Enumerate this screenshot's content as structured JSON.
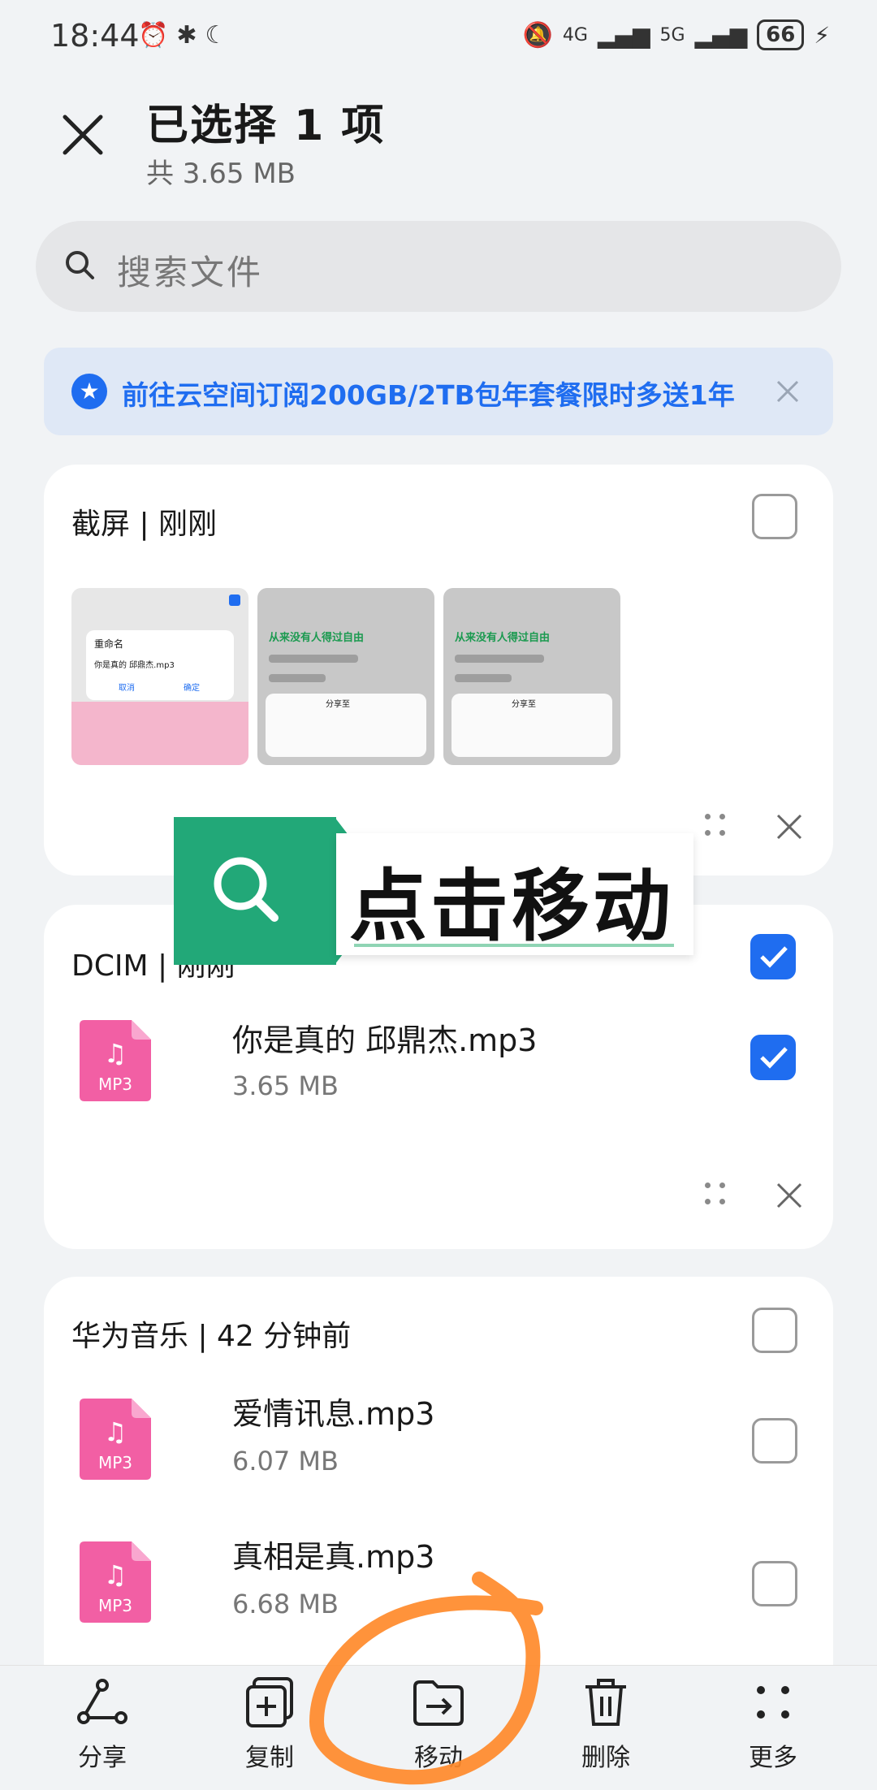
{
  "status_bar": {
    "time": "18:44",
    "network_1": "4G",
    "network_2": "5G",
    "battery": "66"
  },
  "header": {
    "title": "已选择 1 项",
    "subtitle": "共 3.65 MB"
  },
  "search": {
    "placeholder": "搜索文件"
  },
  "promo": {
    "text": "前往云空间订阅200GB/2TB包年套餐限时多送1年",
    "accent_color": "#1f6df0"
  },
  "groups": [
    {
      "title": "截屏 | 刚刚",
      "checked": false,
      "thumbnails": [
        {
          "heading": "重命名",
          "line": "你是真的 邱鼎杰.mp3",
          "cancel": "取消",
          "ok": "确定"
        },
        {
          "heading": "从来没有人得过自由",
          "share": "分享至"
        },
        {
          "heading": "从来没有人得过自由",
          "share": "分享至"
        }
      ]
    },
    {
      "title": "DCIM | 刚刚",
      "checked": true,
      "files": [
        {
          "name": "你是真的 邱鼎杰.mp3",
          "size": "3.65 MB",
          "checked": true
        }
      ]
    },
    {
      "title": "华为音乐 | 42 分钟前",
      "checked": false,
      "files": [
        {
          "name": "爱情讯息.mp3",
          "size": "6.07 MB",
          "checked": false
        },
        {
          "name": "真相是真.mp3",
          "size": "6.68 MB",
          "checked": false
        }
      ]
    }
  ],
  "file_icon_label": "MP3",
  "overlay": {
    "text": "点击移动"
  },
  "toolbar": {
    "share": "分享",
    "copy": "复制",
    "move": "移动",
    "delete": "删除",
    "more": "更多"
  }
}
